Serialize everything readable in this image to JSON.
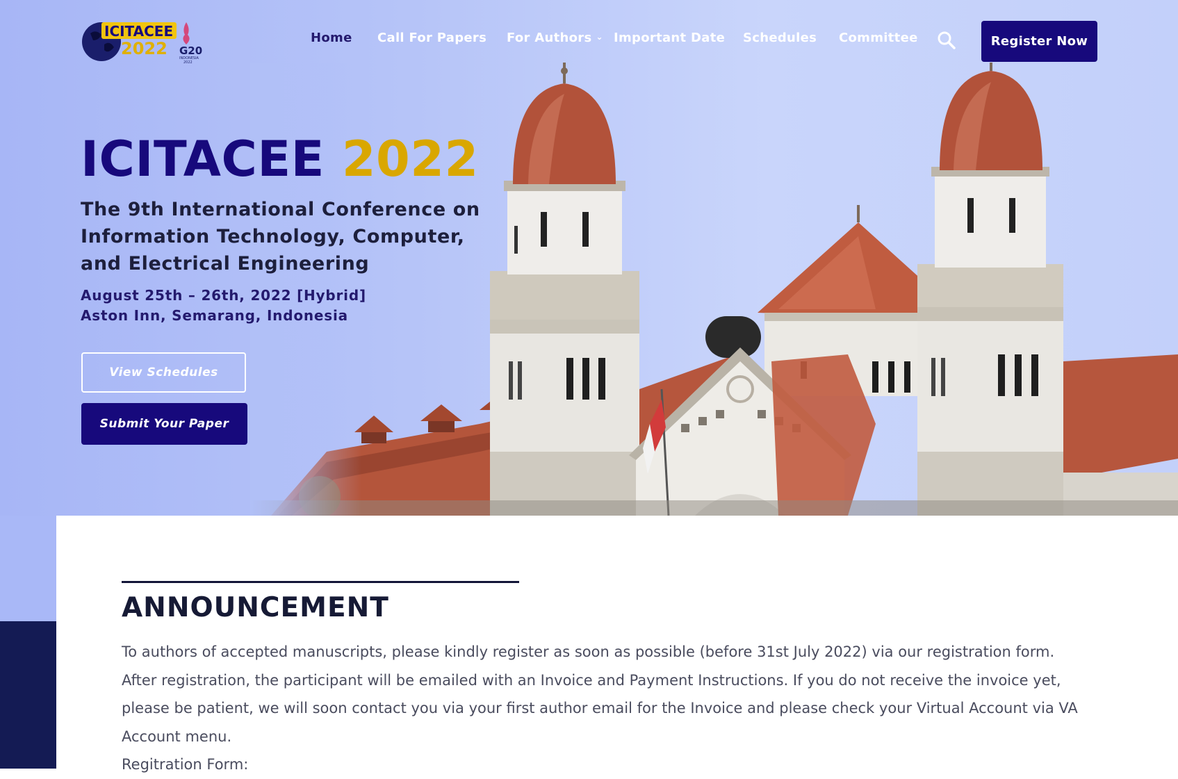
{
  "logo": {
    "text_top": "ICITACEE",
    "text_year": "2022",
    "g20": "G20",
    "g20_sub": "INDONESIA",
    "g20_sub2": "2022"
  },
  "nav": {
    "items": [
      {
        "label": "Home",
        "active": true
      },
      {
        "label": "Call For Papers"
      },
      {
        "label": "For Authors",
        "dropdown": true
      },
      {
        "label": "Important Date"
      },
      {
        "label": "Schedules"
      },
      {
        "label": "Committee"
      }
    ],
    "search_icon": "search-icon",
    "chevron_icon": "chevron-down-icon",
    "register_label": "Register Now"
  },
  "hero": {
    "title": "ICITACEE",
    "year": "2022",
    "subtitle": "The 9th International Conference on Information Technology, Computer, and Electrical Engineering",
    "date": "August 25th – 26th, 2022 [Hybrid]",
    "venue": "Aston Inn, Semarang, Indonesia",
    "view_schedules_label": "View Schedules",
    "submit_paper_label": "Submit Your Paper"
  },
  "announcement": {
    "title": "ANNOUNCEMENT",
    "paragraphs": [
      "To authors of accepted manuscripts, please kindly register as soon as possible (before 31st July 2022) via our registration form.",
      "After registration, the participant will be emailed with an Invoice and Payment Instructions. If you do not receive the invoice yet, please be patient, we will soon contact you via your first author email for the Invoice and please check your Virtual Account via VA Account menu.",
      "Regitration Form:"
    ]
  },
  "colors": {
    "brand_navy": "#17097c",
    "brand_gold": "#d9a700",
    "hero_bg": "#b6c4f8",
    "dark_block": "#141b54"
  }
}
